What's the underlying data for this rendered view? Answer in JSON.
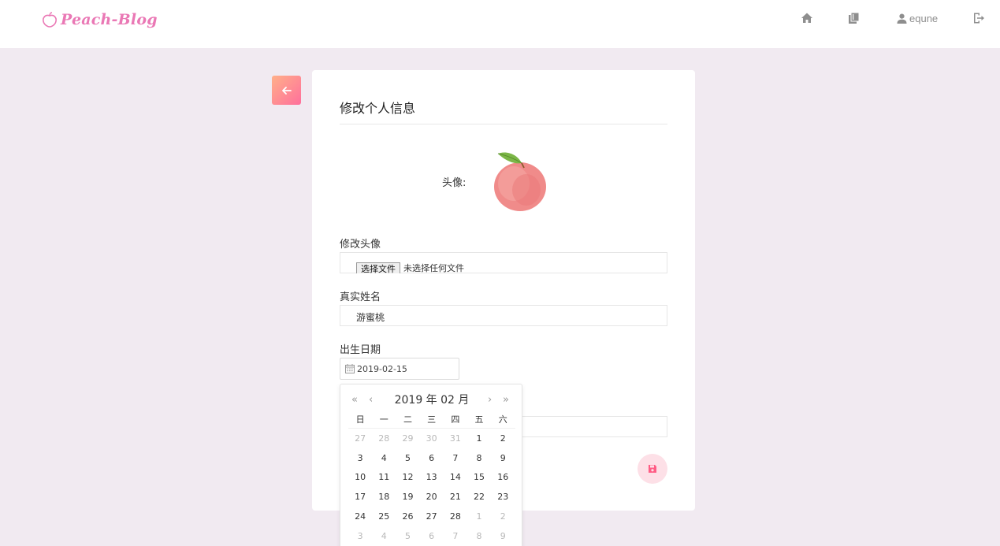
{
  "header": {
    "logo_text": "Peach-Blog",
    "username": "equne",
    "icons": [
      "home-icon",
      "books-icon",
      "user-icon",
      "logout-icon"
    ]
  },
  "back_button": {
    "icon": "arrow-left-icon"
  },
  "card": {
    "title": "修改个人信息",
    "avatar_label": "头像:",
    "change_avatar_label": "修改头像",
    "file_button_label": "选择文件",
    "file_status": "未选择任何文件",
    "real_name_label": "真实姓名",
    "real_name_value": "游蜜桃",
    "birth_date_label": "出生日期",
    "birth_date_value": "2019-02-15",
    "save_icon": "save-icon"
  },
  "calendar": {
    "year_month": "2019 年 02 月",
    "prev_year": "«",
    "prev_month": "‹",
    "next_month": "›",
    "next_year": "»",
    "weekdays": [
      "日",
      "一",
      "二",
      "三",
      "四",
      "五",
      "六"
    ],
    "weeks": [
      [
        {
          "d": "27",
          "m": true
        },
        {
          "d": "28",
          "m": true
        },
        {
          "d": "29",
          "m": true
        },
        {
          "d": "30",
          "m": true
        },
        {
          "d": "31",
          "m": true
        },
        {
          "d": "1",
          "m": false
        },
        {
          "d": "2",
          "m": false
        }
      ],
      [
        {
          "d": "3",
          "m": false
        },
        {
          "d": "4",
          "m": false
        },
        {
          "d": "5",
          "m": false
        },
        {
          "d": "6",
          "m": false
        },
        {
          "d": "7",
          "m": false
        },
        {
          "d": "8",
          "m": false
        },
        {
          "d": "9",
          "m": false
        }
      ],
      [
        {
          "d": "10",
          "m": false
        },
        {
          "d": "11",
          "m": false
        },
        {
          "d": "12",
          "m": false
        },
        {
          "d": "13",
          "m": false
        },
        {
          "d": "14",
          "m": false
        },
        {
          "d": "15",
          "m": false
        },
        {
          "d": "16",
          "m": false
        }
      ],
      [
        {
          "d": "17",
          "m": false
        },
        {
          "d": "18",
          "m": false
        },
        {
          "d": "19",
          "m": false
        },
        {
          "d": "20",
          "m": false
        },
        {
          "d": "21",
          "m": false
        },
        {
          "d": "22",
          "m": false
        },
        {
          "d": "23",
          "m": false
        }
      ],
      [
        {
          "d": "24",
          "m": false
        },
        {
          "d": "25",
          "m": false
        },
        {
          "d": "26",
          "m": false
        },
        {
          "d": "27",
          "m": false
        },
        {
          "d": "28",
          "m": false
        },
        {
          "d": "1",
          "m": true
        },
        {
          "d": "2",
          "m": true
        }
      ],
      [
        {
          "d": "3",
          "m": true
        },
        {
          "d": "4",
          "m": true
        },
        {
          "d": "5",
          "m": true
        },
        {
          "d": "6",
          "m": true
        },
        {
          "d": "7",
          "m": true
        },
        {
          "d": "8",
          "m": true
        },
        {
          "d": "9",
          "m": true
        }
      ]
    ]
  },
  "colors": {
    "accent_pink": "#ea78b5",
    "save_bg": "#fde0e7",
    "save_icon": "#ff5d85",
    "page_bg": "#f1eaf1"
  }
}
